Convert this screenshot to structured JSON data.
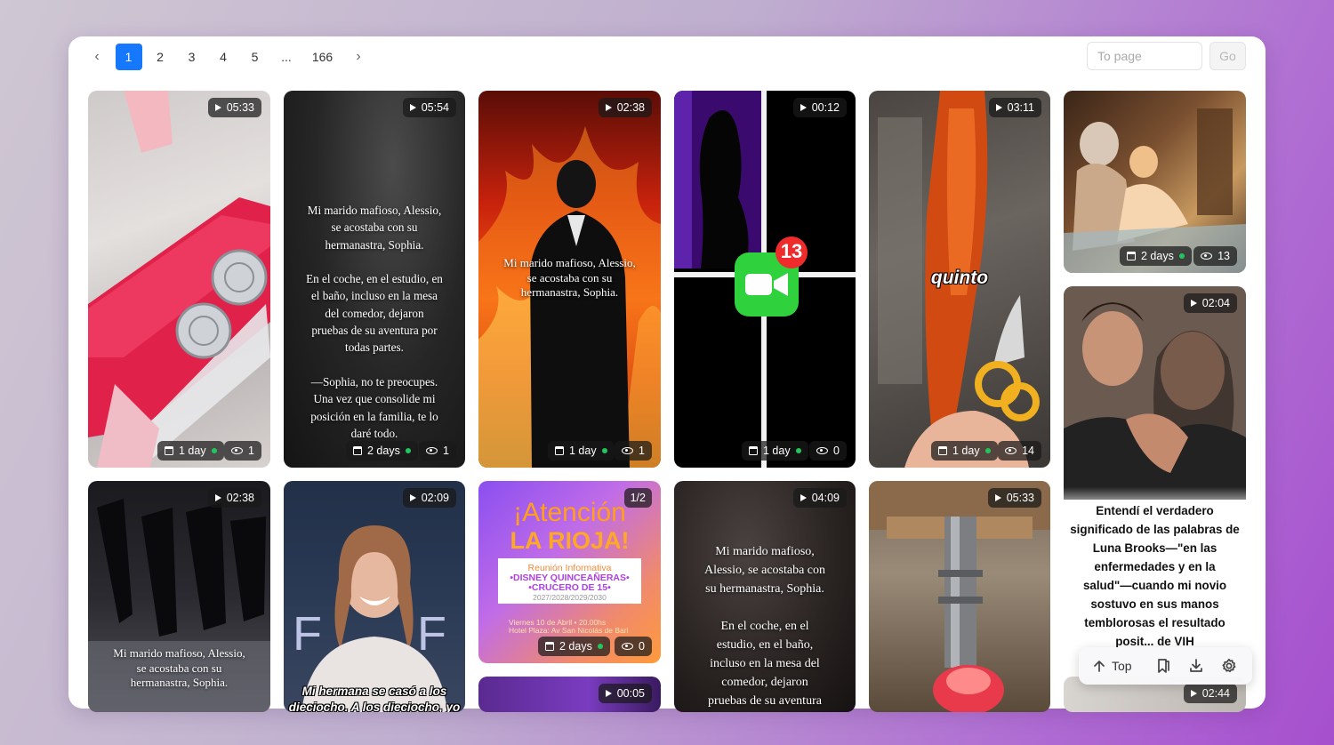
{
  "pagination": {
    "prev_icon": "chevron-left-icon",
    "next_icon": "chevron-right-icon",
    "pages": [
      "1",
      "2",
      "3",
      "4",
      "5",
      "...",
      "166"
    ],
    "current": "1",
    "to_page_placeholder": "To page",
    "go_label": "Go"
  },
  "cards": [
    {
      "duration": "05:33",
      "age": "1 day",
      "views": "1",
      "caption": ""
    },
    {
      "duration": "05:54",
      "age": "2 days",
      "views": "1",
      "caption": "Mi marido mafioso, Alessio,\nse acostaba con su\nhermanastra, Sophia.\n\nEn el coche, en el estudio, en\nel baño, incluso en la mesa\ndel comedor, dejaron\npruebas de su aventura por\ntodas partes.\n\n—Sophia, no te preocupes.\nUna vez que consolide mi\nposición en la familia, te lo\ndaré todo."
    },
    {
      "duration": "02:38",
      "age": "1 day",
      "views": "1",
      "caption": "Mi marido mafioso, Alessio,\nse acostaba con su\nhermanastra, Sophia."
    },
    {
      "duration": "00:12",
      "age": "1 day",
      "views": "0",
      "caption": "",
      "badge": "13"
    },
    {
      "duration": "03:11",
      "age": "1 day",
      "views": "14",
      "caption": "quinto"
    },
    {
      "duration": "",
      "age": "2 days",
      "views": "13",
      "caption": ""
    },
    {
      "duration": "02:04",
      "age": "",
      "views": "",
      "caption": "Entendí el verdadero\nsignificado de las palabras de\nLuna Brooks—\"en las\nenfermedades y en la\nsalud\"—cuando mi novio\nsostuvo en sus manos\ntemblorosas el resultado\nposit... de VIH"
    },
    {
      "duration": "02:38",
      "age": "",
      "views": "",
      "caption": "Mi marido mafioso, Alessio,\nse acostaba con su\nhermanastra, Sophia."
    },
    {
      "duration": "02:09",
      "age": "",
      "views": "",
      "caption": "Mi hermana se casó a los\ndieciocho. A los dieciocho, yo"
    },
    {
      "duration": "1/2",
      "age": "2 days",
      "views": "0",
      "caption": "",
      "poster": {
        "title1": "¡Atención",
        "title2": "LA RIOJA!",
        "box1": "Reunión Informativa",
        "box2": "•DISNEY QUINCEAÑERAS•",
        "box3": "•CRUCERO DE 15•",
        "box4": "2027/2028/2029/2030",
        "foot1": "Viernes 10 de Abril • 20.00hs",
        "foot2": "Hotel Plaza: Av San Nicolás de Bari"
      }
    },
    {
      "duration": "04:09",
      "age": "",
      "views": "",
      "caption": "Mi marido mafioso,\nAlessio, se acostaba con\nsu hermanastra, Sophia.\n\nEn el coche, en el\nestudio, en el baño,\nincluso en la mesa del\ncomedor, dejaron\npruebas de su aventura"
    },
    {
      "duration": "05:33",
      "age": "",
      "views": "",
      "caption": ""
    },
    {
      "duration": "00:05",
      "age": "",
      "views": "",
      "caption": ""
    },
    {
      "duration": "02:44",
      "age": "",
      "views": "",
      "caption": ""
    }
  ],
  "toolbar": {
    "top_label": "Top",
    "top_icon": "arrow-up-icon",
    "bookmark_icon": "bookmark-icon",
    "download_icon": "download-icon",
    "settings_icon": "gear-icon"
  }
}
